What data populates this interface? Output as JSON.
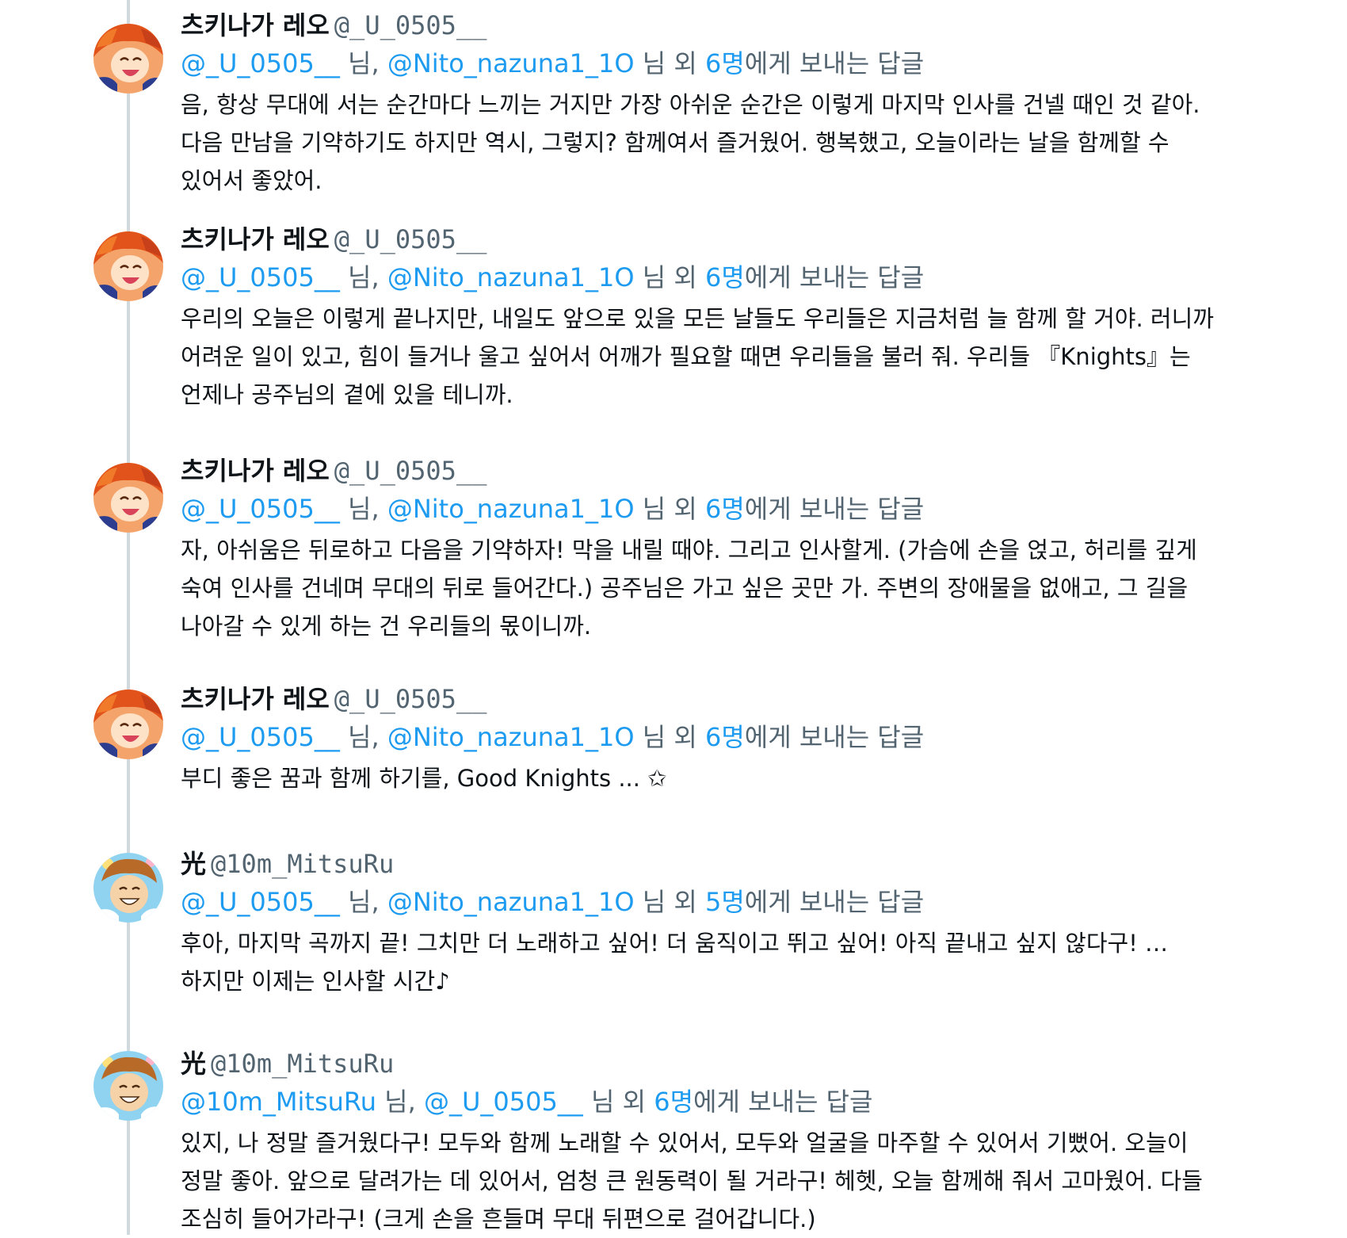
{
  "tweets": [
    {
      "name": "츠키나가 레오",
      "handle": "@_U_0505__",
      "avatar": "leo-avatar",
      "reply": {
        "m1": "@_U_0505__",
        "s1": " 님, ",
        "m2": "@Nito_nazuna1_1O",
        "s2": " 님 외 ",
        "count": "6명",
        "tail": "에게 보내는 답글"
      },
      "text": "음, 항상 무대에 서는 순간마다 느끼는 거지만 가장 아쉬운 순간은 이렇게 마지막 인사를 건넬 때인 것 같아. 다음 만남을 기약하기도 하지만 역시, 그렇지? 함께여서 즐거웠어. 행복했고, 오늘이라는 날을 함께할 수 있어서 좋았어."
    },
    {
      "name": "츠키나가 레오",
      "handle": "@_U_0505__",
      "avatar": "leo-avatar",
      "reply": {
        "m1": "@_U_0505__",
        "s1": " 님, ",
        "m2": "@Nito_nazuna1_1O",
        "s2": " 님 외 ",
        "count": "6명",
        "tail": "에게 보내는 답글"
      },
      "text": "우리의 오늘은 이렇게 끝나지만, 내일도 앞으로 있을 모든 날들도 우리들은 지금처럼 늘 함께 할 거야. 러니까 어려운 일이 있고, 힘이 들거나 울고 싶어서 어깨가 필요할 때면 우리들을 불러 줘. 우리들 『Knights』는 언제나 공주님의 곁에 있을 테니까."
    },
    {
      "name": "츠키나가 레오",
      "handle": "@_U_0505__",
      "avatar": "leo-avatar",
      "reply": {
        "m1": "@_U_0505__",
        "s1": " 님, ",
        "m2": "@Nito_nazuna1_1O",
        "s2": " 님 외 ",
        "count": "6명",
        "tail": "에게 보내는 답글"
      },
      "text": "자, 아쉬움은 뒤로하고 다음을 기약하자! 막을 내릴 때야. 그리고 인사할게. (가슴에 손을 얹고, 허리를 깊게 숙여 인사를 건네며 무대의 뒤로 들어간다.) 공주님은 가고 싶은 곳만 가. 주변의 장애물을 없애고, 그 길을 나아갈 수 있게 하는 건 우리들의 몫이니까."
    },
    {
      "name": "츠키나가 레오",
      "handle": "@_U_0505__",
      "avatar": "leo-avatar",
      "reply": {
        "m1": "@_U_0505__",
        "s1": " 님, ",
        "m2": "@Nito_nazuna1_1O",
        "s2": " 님 외 ",
        "count": "6명",
        "tail": "에게 보내는 답글"
      },
      "text": "부디 좋은 꿈과 함께 하기를, Good Knights ... ✩"
    },
    {
      "name": "光",
      "handle": "@10m_MitsuRu",
      "avatar": "mitsuru-avatar",
      "reply": {
        "m1": "@_U_0505__",
        "s1": " 님, ",
        "m2": "@Nito_nazuna1_1O",
        "s2": " 님 외 ",
        "count": "5명",
        "tail": "에게 보내는 답글"
      },
      "text": "후아, 마지막 곡까지 끝! 그치만 더 노래하고 싶어! 더 움직이고 뛰고 싶어! 아직 끝내고 싶지 않다구! …하지만 이제는 인사할 시간♪"
    },
    {
      "name": "光",
      "handle": "@10m_MitsuRu",
      "avatar": "mitsuru-avatar",
      "reply": {
        "m1": "@10m_MitsuRu",
        "s1": " 님, ",
        "m2": "@_U_0505__",
        "s2": " 님 외 ",
        "count": "6명",
        "tail": "에게 보내는 답글"
      },
      "text": "있지, 나 정말 즐거웠다구! 모두와 함께 노래할 수 있어서, 모두와 얼굴을 마주할 수 있어서 기뻤어. 오늘이 정말 좋아. 앞으로 달려가는 데 있어서, 엄청 큰 원동력이 될 거라구! 헤헷, 오늘 함께해 줘서 고마웠어. 다들 조심히 들어가라구! (크게 손을 흔들며 무대 뒤편으로 걸어갑니다.)"
    }
  ]
}
